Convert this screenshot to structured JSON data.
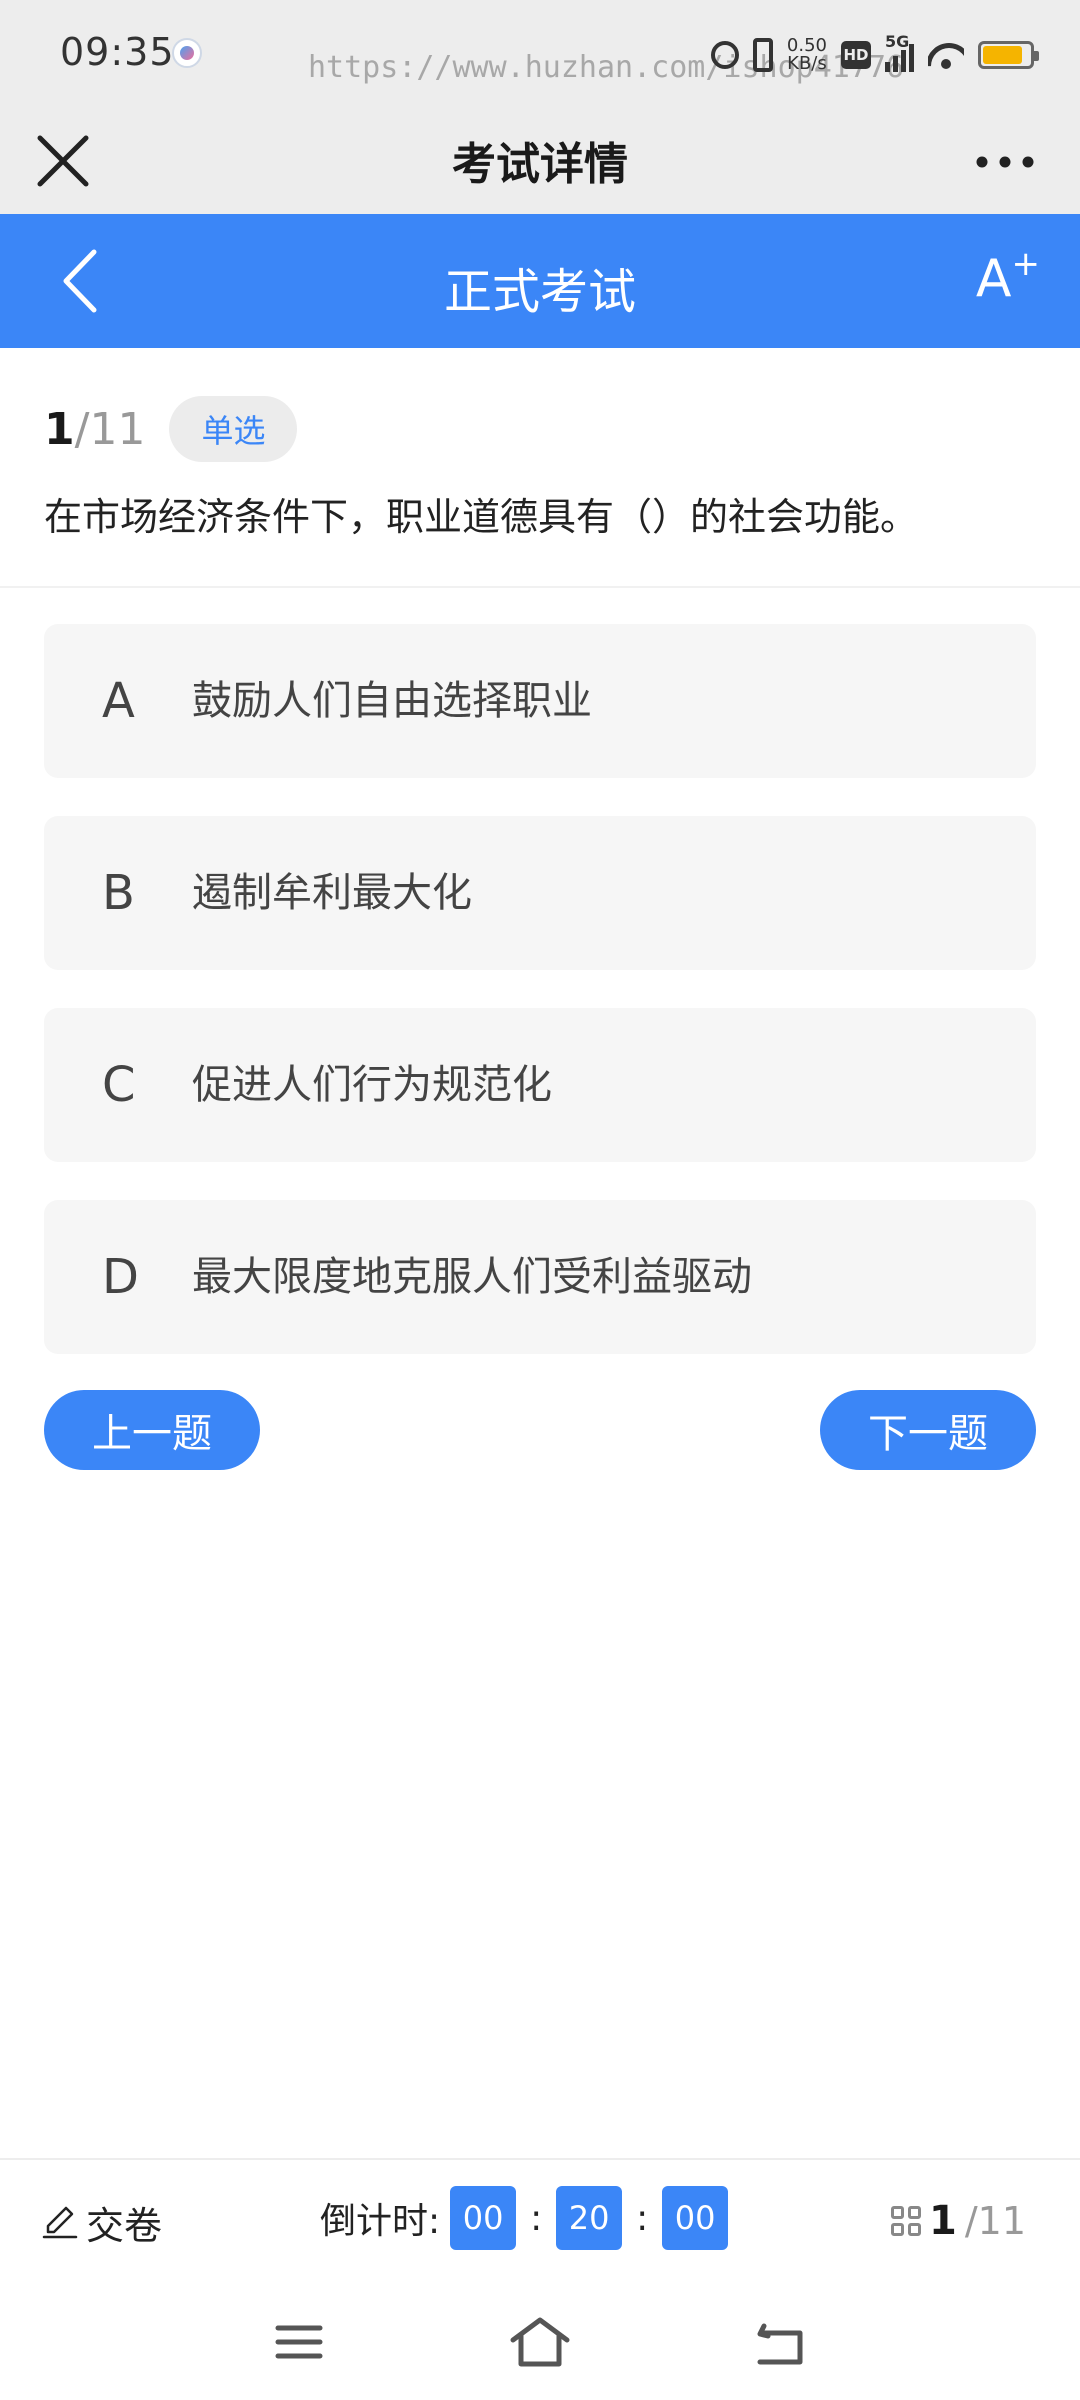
{
  "status_bar": {
    "time": "09:35",
    "watermark": "https://www.huzhan.com/ishop41776",
    "net_speed_value": "0.50",
    "net_speed_unit": "KB/s",
    "hd_label": "HD",
    "network_label": "5G",
    "battery_level": 0.85,
    "battery_color": "#f5b400"
  },
  "title_bar": {
    "title": "考试详情"
  },
  "exam_header": {
    "title": "正式考试",
    "font_button_label": "A",
    "font_button_sup": "+",
    "color": "#3b86f7"
  },
  "question": {
    "current": "1",
    "total": "/11",
    "type": "单选",
    "text": "在市场经济条件下，职业道德具有（）的社会功能。"
  },
  "options": [
    {
      "letter": "A",
      "text": "鼓励人们自由选择职业"
    },
    {
      "letter": "B",
      "text": "遏制牟利最大化"
    },
    {
      "letter": "C",
      "text": "促进人们行为规范化"
    },
    {
      "letter": "D",
      "text": "最大限度地克服人们受利益驱动"
    }
  ],
  "navigation": {
    "prev_label": "上一题",
    "next_label": "下一题"
  },
  "bottom_bar": {
    "submit_label": "交卷",
    "countdown_label": "倒计时:",
    "hours": "00",
    "minutes": "20",
    "seconds": "00",
    "separator": ":",
    "progress_current": "1",
    "progress_total": "/11"
  },
  "icons": {
    "close": "close-icon",
    "more": "more-icon",
    "back": "back-icon",
    "edit": "edit-icon",
    "grid": "grid-icon",
    "menu": "menu-icon",
    "home": "home-icon",
    "return": "return-icon"
  }
}
